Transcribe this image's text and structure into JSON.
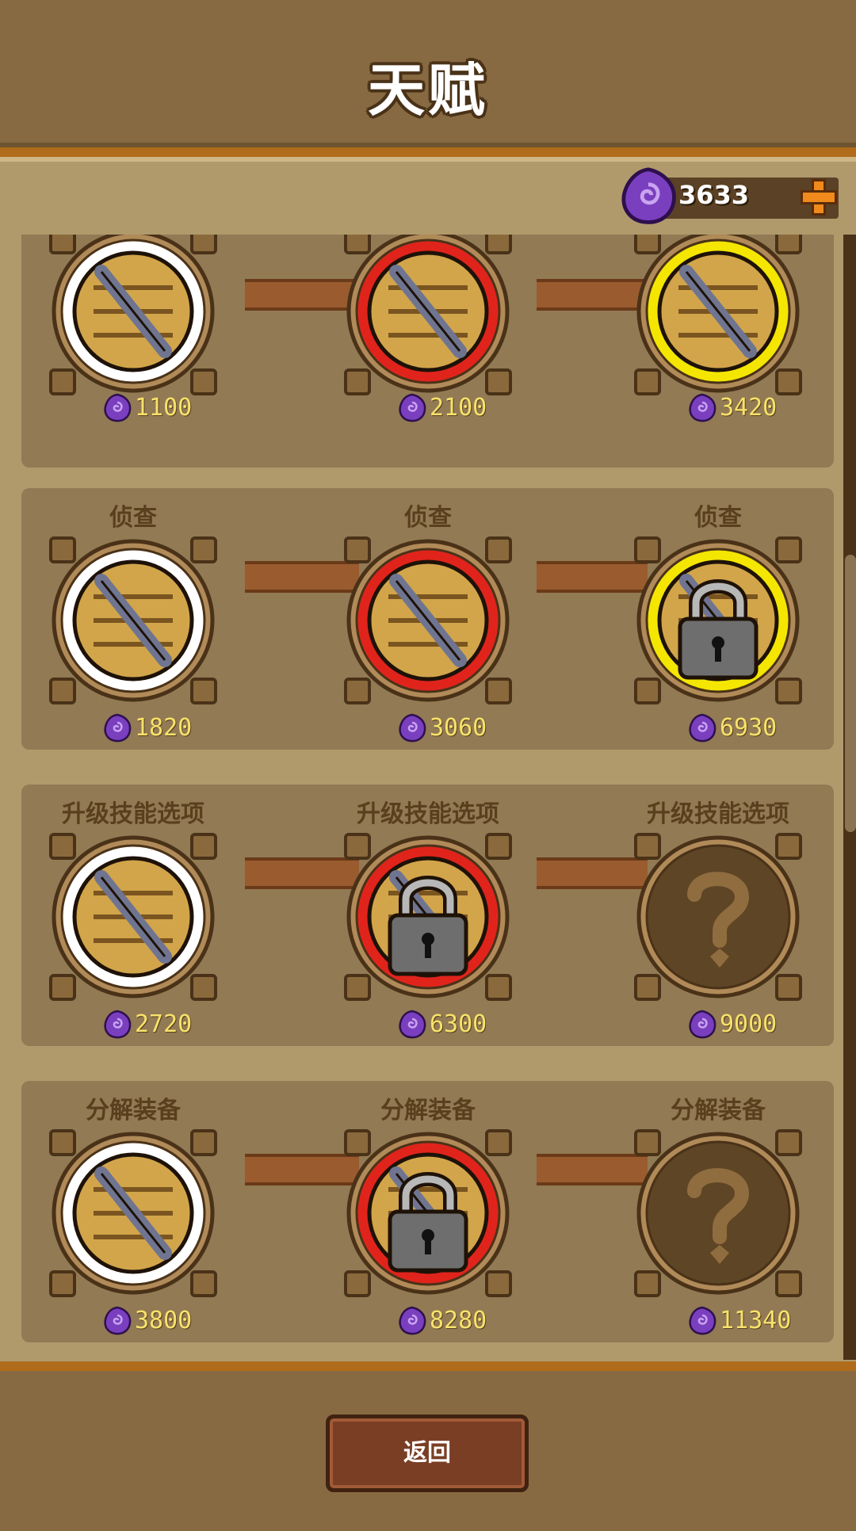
{
  "header": {
    "title": "天赋"
  },
  "currency": {
    "value": "3633",
    "gem_icon": "purple-gem-icon",
    "add_icon": "plus-icon"
  },
  "rows": [
    {
      "label": "",
      "nodes": [
        {
          "icon": "gem-pile-tier1-icon",
          "state": "unlocked",
          "glow": "white",
          "price": "1100"
        },
        {
          "icon": "gem-trophy-tier2-icon",
          "state": "unlocked",
          "glow": "red",
          "price": "2100"
        },
        {
          "icon": "treasure-hoard-tier3-icon",
          "state": "unlocked",
          "glow": "yellow",
          "price": "3420"
        }
      ]
    },
    {
      "label": "侦查",
      "nodes": [
        {
          "icon": "telescope-crate-icon",
          "state": "unlocked",
          "glow": "white",
          "price": "1820"
        },
        {
          "icon": "magnifier-telescope-crate-icon",
          "state": "unlocked",
          "glow": "red",
          "price": "3060"
        },
        {
          "icon": "lock-icon",
          "state": "locked",
          "glow": "yellow",
          "price": "6930"
        }
      ]
    },
    {
      "label": "升级技能选项",
      "nodes": [
        {
          "icon": "laurel-totem-icon",
          "state": "unlocked",
          "glow": "white",
          "price": "2720"
        },
        {
          "icon": "lock-icon",
          "state": "locked",
          "glow": "red",
          "price": "6300"
        },
        {
          "icon": "question-mark-icon",
          "state": "unknown",
          "glow": "none",
          "price": "9000"
        }
      ]
    },
    {
      "label": "分解装备",
      "nodes": [
        {
          "icon": "anvil-icon",
          "state": "unlocked",
          "glow": "white",
          "price": "3800"
        },
        {
          "icon": "lock-icon",
          "state": "locked",
          "glow": "red",
          "price": "8280"
        },
        {
          "icon": "question-mark-icon",
          "state": "unknown",
          "glow": "none",
          "price": "11340"
        }
      ]
    }
  ],
  "footer": {
    "back_label": "返回"
  },
  "colors": {
    "glow_white": "#ffffff",
    "glow_red": "#e0241c",
    "glow_yellow": "#f4e600",
    "price": "#f7e26b",
    "gem": "#7a3fbf"
  }
}
